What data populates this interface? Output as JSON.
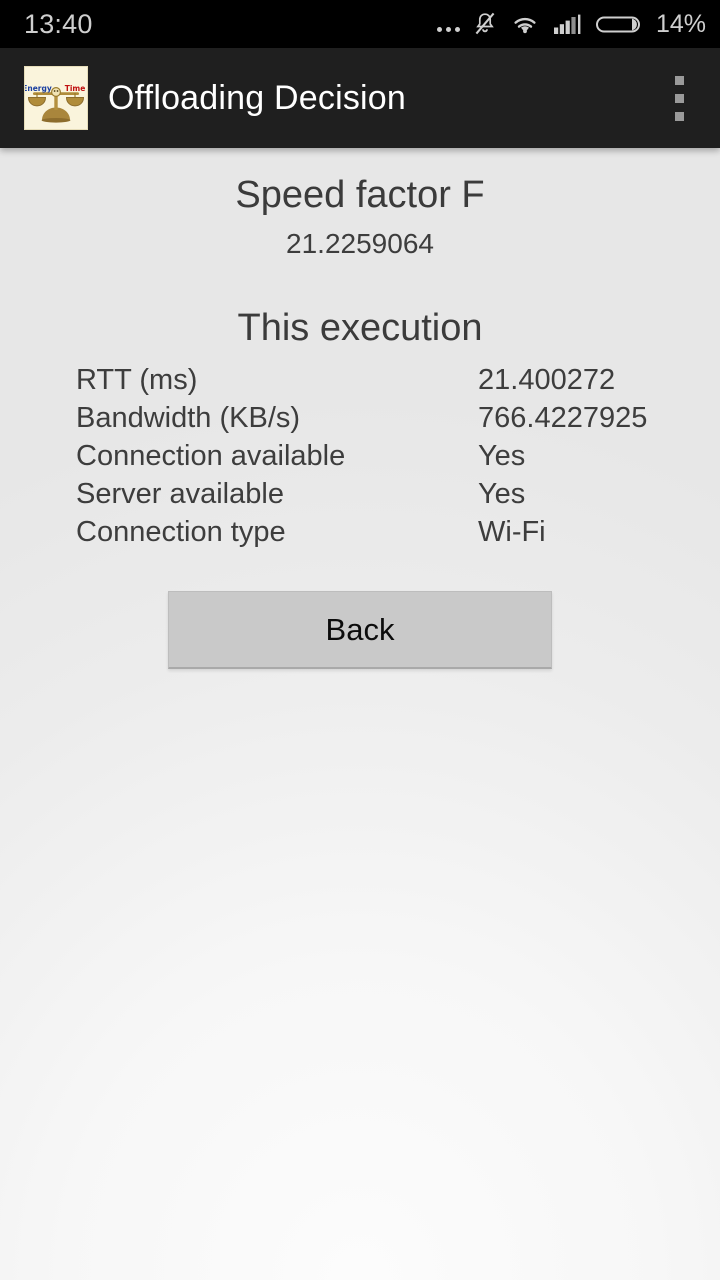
{
  "status_bar": {
    "time": "13:40",
    "battery_percent": "14%",
    "icons": [
      "more-ellipsis-icon",
      "notifications-muted-icon",
      "wifi-icon",
      "cellular-signal-icon",
      "battery-icon"
    ]
  },
  "app_bar": {
    "title": "Offloading Decision",
    "app_icon": "balance-scale-icon",
    "app_icon_left_label": "Energy",
    "app_icon_right_label": "Time",
    "overflow_menu": "overflow-menu-icon"
  },
  "main": {
    "speed_factor": {
      "title": "Speed factor F",
      "value": "21.2259064"
    },
    "execution": {
      "title": "This execution",
      "rows": [
        {
          "label": "RTT (ms)",
          "value": "21.400272"
        },
        {
          "label": "Bandwidth (KB/s)",
          "value": "766.4227925"
        },
        {
          "label": "Connection available",
          "value": "Yes"
        },
        {
          "label": "Server available",
          "value": "Yes"
        },
        {
          "label": "Connection type",
          "value": "Wi-Fi"
        }
      ]
    },
    "back_button": "Back"
  },
  "colors": {
    "status_bar_bg": "#000000",
    "app_bar_bg": "#1f1f1f",
    "app_bar_text": "#ffffff",
    "content_bg_top": "#e7e7e7",
    "content_bg_bottom": "#fcfcfc",
    "body_text": "#3d3d3d",
    "button_bg": "#c9c9c9",
    "icon_label_energy": "#1a3fa0",
    "icon_label_time": "#c01010"
  }
}
